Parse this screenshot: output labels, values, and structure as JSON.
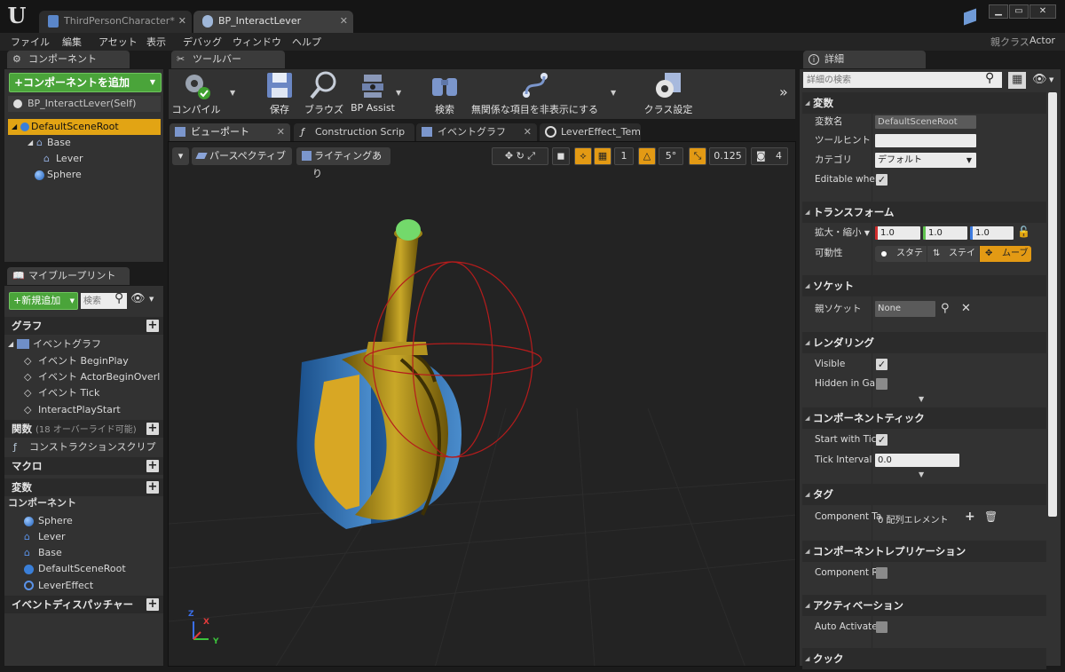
{
  "tabs": [
    {
      "label": "ThirdPersonCharacter*"
    },
    {
      "label": "BP_InteractLever"
    }
  ],
  "menu": [
    "ファイル",
    "編集",
    "アセット",
    "表示",
    "デバッグ",
    "ウィンドウ",
    "ヘルプ"
  ],
  "parent_class": {
    "label": "親クラス",
    "value": "Actor"
  },
  "components_panel": {
    "tab": "コンポーネント",
    "add_button": "+コンポーネントを追加",
    "self_item": "BP_InteractLever(Self)",
    "tree": [
      "DefaultSceneRoot",
      "Base",
      "Lever",
      "Sphere"
    ]
  },
  "myblueprint_panel": {
    "tab": "マイブループリント",
    "add_button": "+新規追加",
    "search_placeholder": "検索",
    "graph_header": "グラフ",
    "event_graph": "イベントグラフ",
    "events": [
      "イベント BeginPlay",
      "イベント ActorBeginOverl",
      "イベント Tick",
      "InteractPlayStart"
    ],
    "functions_header": "関数",
    "functions_note": "(18 オーバーライド可能)",
    "construction_script": "コンストラクションスクリプ",
    "macros_header": "マクロ",
    "variables_header": "変数",
    "components_header": "コンポーネント",
    "components": [
      "Sphere",
      "Lever",
      "Base",
      "DefaultSceneRoot",
      "LeverEffect"
    ],
    "dispatchers_header": "イベントディスパッチャー"
  },
  "toolbar": {
    "tab": "ツールバー",
    "compile": "コンパイル",
    "save": "保存",
    "browse": "ブラウズ",
    "bp_assist": "BP Assist",
    "search": "検索",
    "hide_unrelated": "無関係な項目を非表示にする",
    "class_settings": "クラス設定"
  },
  "editor_tabs": [
    "ビューポート",
    "Construction Scrip",
    "イベントグラフ",
    "LeverEffect_Templa"
  ],
  "viewport": {
    "perspective": "パースペクティブ",
    "lighting": "ライティングあり",
    "grid_snap": "1",
    "rotation_snap": "5°",
    "scale_snap": "0.125",
    "camera_speed": "4",
    "axis_x": "X",
    "axis_y": "Y",
    "axis_z": "Z"
  },
  "details": {
    "tab": "詳細",
    "search_placeholder": "詳細の検索",
    "variable_section": "変数",
    "var_name_label": "変数名",
    "var_name_value": "DefaultSceneRoot",
    "tooltip_label": "ツールヒント",
    "category_label": "カテゴリ",
    "category_value": "デフォルト",
    "editable_label": "Editable when",
    "transform_section": "トランスフォーム",
    "scale_label": "拡大・縮小",
    "scale_x": "1.0",
    "scale_y": "1.0",
    "scale_z": "1.0",
    "mobility_label": "可動性",
    "mobility_static": "スタテ",
    "mobility_stationary": "ステイ",
    "mobility_movable": "ムーブ",
    "socket_section": "ソケット",
    "parent_socket_label": "親ソケット",
    "parent_socket_value": "None",
    "rendering_section": "レンダリング",
    "visible_label": "Visible",
    "hidden_label": "Hidden in Gam",
    "tick_section": "コンポーネントティック",
    "start_tick_label": "Start with Tick",
    "tick_interval_label": "Tick Interval (",
    "tick_interval_value": "0.0",
    "tags_section": "タグ",
    "component_tags_label": "Component Ta",
    "component_tags_value": "0 配列エレメント",
    "replication_section": "コンポーネントレプリケーション",
    "component_rep_label": "Component Re",
    "activation_section": "アクティベーション",
    "auto_activate_label": "Auto Activate",
    "cook_section": "クック"
  }
}
